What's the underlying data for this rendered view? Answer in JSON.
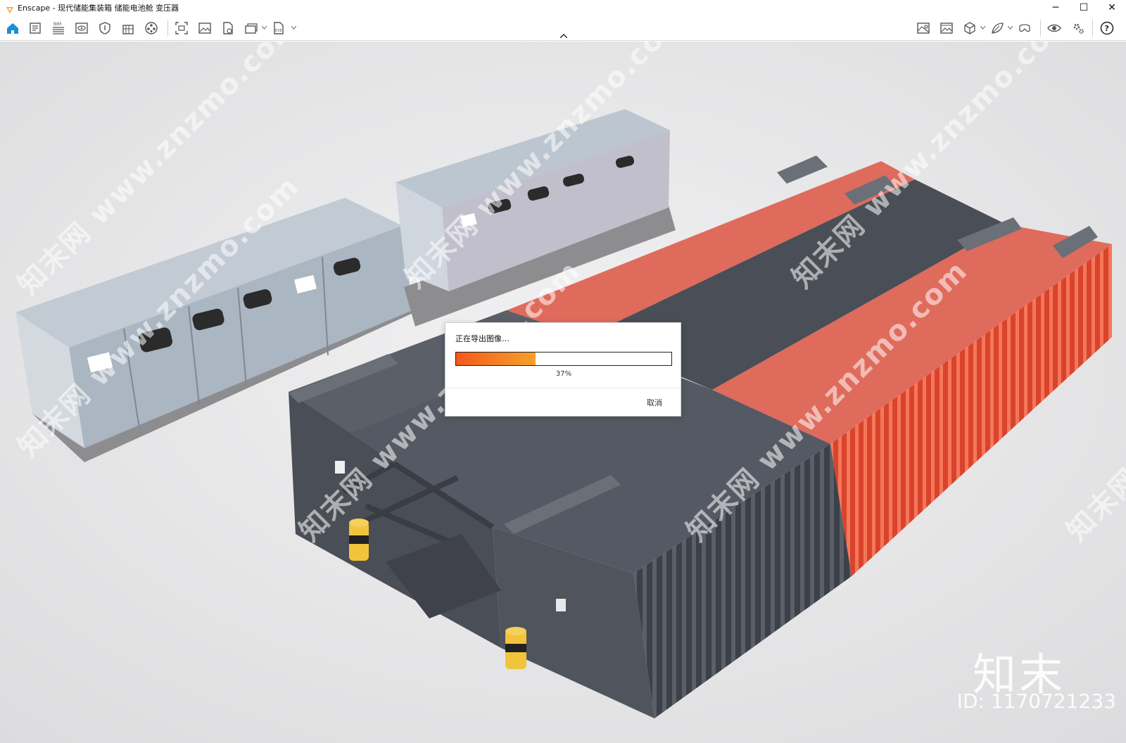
{
  "window": {
    "app_name": "Enscape",
    "title": "Enscape - 现代储能集装箱 储能电池舱 变压器",
    "minimize_glyph": "─",
    "maximize_glyph": "☐",
    "close_glyph": "✕"
  },
  "toolbar": {
    "left_icons": [
      "home-icon",
      "document-icon",
      "bim-icon",
      "view-icon",
      "shield-icon",
      "building-icon",
      "material-icon",
      "capture-icon",
      "image-icon",
      "file-export-icon",
      "batch-render-icon",
      "exe-export-icon"
    ],
    "right_icons": [
      "map-icon",
      "gallery-icon",
      "cube-icon",
      "leaf-icon",
      "vr-headset-icon",
      "visibility-icon",
      "settings-icon",
      "help-icon"
    ],
    "accent_color": "#1a8fd6"
  },
  "dialog": {
    "title": "正在导出图像…",
    "progress_percent": 37,
    "progress_text": "37%",
    "cancel_label": "取消",
    "progress_color_start": "#f25a1e",
    "progress_color_end": "#f7a12a"
  },
  "watermarks": {
    "text": "知末网 www.znzmo.com",
    "brand": "知末",
    "id_text": "ID: 1170721233"
  }
}
